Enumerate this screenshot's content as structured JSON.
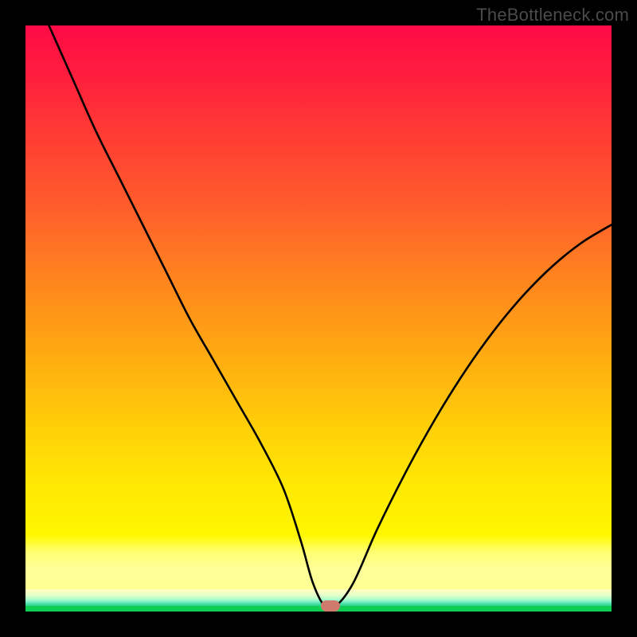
{
  "watermark": "TheBottleneck.com",
  "chart_data": {
    "type": "line",
    "title": "",
    "xlabel": "",
    "ylabel": "",
    "xlim": [
      0,
      100
    ],
    "ylim": [
      0,
      100
    ],
    "series": [
      {
        "name": "bottleneck-curve",
        "x": [
          4,
          8,
          12,
          16,
          20,
          24,
          28,
          32,
          36,
          40,
          44,
          47,
          49,
          51,
          53,
          56,
          60,
          65,
          70,
          75,
          80,
          85,
          90,
          95,
          100
        ],
        "y": [
          100,
          91,
          82,
          74,
          66,
          58,
          50,
          43,
          36,
          29,
          21,
          12,
          5,
          1,
          1,
          5,
          14,
          24,
          33,
          41,
          48,
          54,
          59,
          63,
          66
        ]
      }
    ],
    "annotations": [
      {
        "name": "minimum-marker",
        "x": 52,
        "y": 1
      }
    ],
    "background": {
      "type": "vertical-gradient",
      "stops": [
        "#ff0a46",
        "#ff9818",
        "#ffff00",
        "#0fce56"
      ],
      "meaning": "red=bad, green=ideal"
    }
  }
}
